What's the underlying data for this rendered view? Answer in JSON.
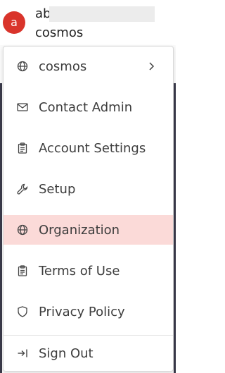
{
  "user": {
    "avatar_letter": "a",
    "name": "ab",
    "org": "cosmos"
  },
  "menu": {
    "items": [
      {
        "label": "cosmos",
        "icon": "globe-icon",
        "has_submenu": true
      },
      {
        "label": "Contact Admin",
        "icon": "mail-icon"
      },
      {
        "label": "Account Settings",
        "icon": "clipboard-icon"
      },
      {
        "label": "Setup",
        "icon": "wrench-icon"
      },
      {
        "label": "Organization",
        "icon": "globe-icon",
        "active": true
      },
      {
        "label": "Terms of Use",
        "icon": "clipboard-icon"
      },
      {
        "label": "Privacy Policy",
        "icon": "shield-icon"
      },
      {
        "label": "Sign Out",
        "icon": "sign-out-icon"
      }
    ]
  },
  "colors": {
    "accent": "#d9342b",
    "active_bg": "#fbdad8"
  }
}
